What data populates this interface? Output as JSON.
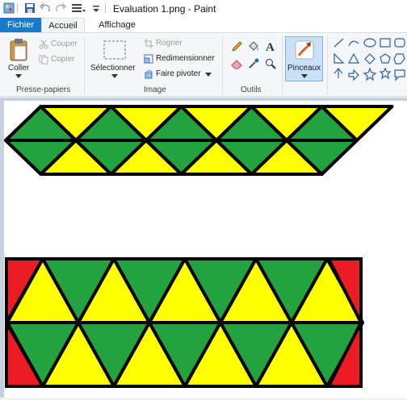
{
  "window": {
    "title": "Evaluation 1.png - Paint"
  },
  "tabs": {
    "fichier": "Fichier",
    "accueil": "Accueil",
    "affichage": "Affichage"
  },
  "presse_papiers": {
    "coller": "Coller",
    "couper": "Couper",
    "copier": "Copier",
    "label": "Presse-papiers"
  },
  "image": {
    "selectionner": "Sélectionner",
    "rogner": "Rogner",
    "redimensionner": "Redimensionner",
    "faire_pivoter": "Faire pivoter",
    "label": "Image"
  },
  "outils": {
    "label": "Outils"
  },
  "pinceaux": {
    "label": "Pinceaux"
  },
  "colors": {
    "yellow": "#ffff00",
    "green": "#22a33f",
    "red": "#ec1c24",
    "outline": "#000000",
    "ribbon": "#f5f6f7",
    "tab_active": "#1979ca"
  },
  "drawing": {
    "top_shape": {
      "row1": [
        "green",
        "yellow",
        "green",
        "yellow",
        "green",
        "yellow",
        "green",
        "yellow",
        "green",
        "yellow"
      ],
      "row2": [
        "green",
        "yellow",
        "green",
        "yellow",
        "green",
        "yellow",
        "green",
        "yellow",
        "green"
      ]
    },
    "bottom_shape": {
      "row1": [
        "red",
        "yellow",
        "green",
        "yellow",
        "green",
        "yellow",
        "green",
        "yellow",
        "green",
        "yellow",
        "red"
      ],
      "row2": [
        "red",
        "green",
        "yellow",
        "green",
        "yellow",
        "green",
        "yellow",
        "green",
        "yellow",
        "green",
        "red"
      ]
    }
  }
}
